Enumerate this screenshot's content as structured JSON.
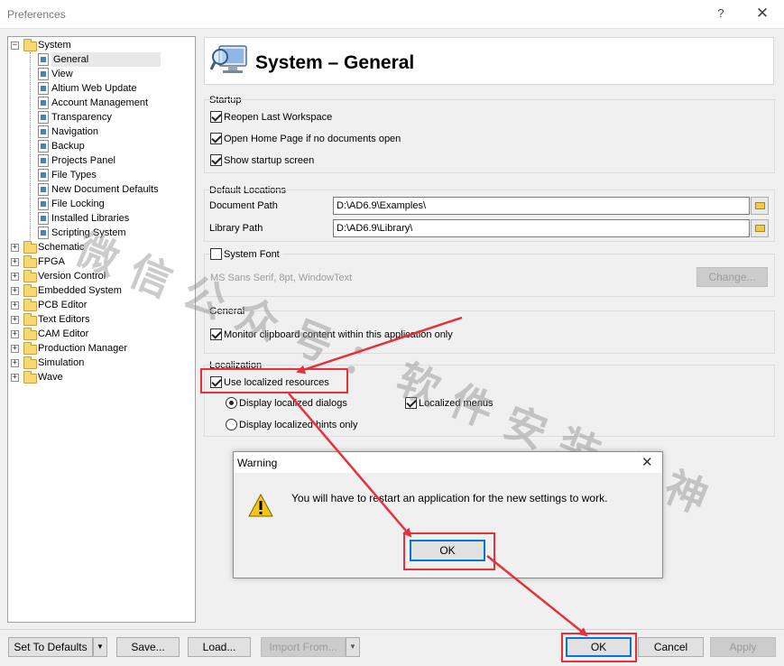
{
  "window": {
    "title": "Preferences",
    "help": "?",
    "close": "✕"
  },
  "tree": {
    "items": [
      {
        "label": "System",
        "expander": "−"
      },
      {
        "label": "General"
      },
      {
        "label": "View"
      },
      {
        "label": "Altium Web Update"
      },
      {
        "label": "Account Management"
      },
      {
        "label": "Transparency"
      },
      {
        "label": "Navigation"
      },
      {
        "label": "Backup"
      },
      {
        "label": "Projects Panel"
      },
      {
        "label": "File Types"
      },
      {
        "label": "New Document Defaults"
      },
      {
        "label": "File Locking"
      },
      {
        "label": "Installed Libraries"
      },
      {
        "label": "Scripting System"
      },
      {
        "label": "Schematic",
        "expander": "+"
      },
      {
        "label": "FPGA",
        "expander": "+"
      },
      {
        "label": "Version Control",
        "expander": "+"
      },
      {
        "label": "Embedded System",
        "expander": "+"
      },
      {
        "label": "PCB Editor",
        "expander": "+"
      },
      {
        "label": "Text Editors",
        "expander": "+"
      },
      {
        "label": "CAM Editor",
        "expander": "+"
      },
      {
        "label": "Production Manager",
        "expander": "+"
      },
      {
        "label": "Simulation",
        "expander": "+"
      },
      {
        "label": "Wave",
        "expander": "+"
      }
    ]
  },
  "header": {
    "title": "System – General",
    "icon": "monitor-magnifier-icon"
  },
  "startup": {
    "label": "Startup",
    "reopen": "Reopen Last Workspace",
    "home_page": "Open Home Page if no documents open",
    "startup_screen": "Show startup screen"
  },
  "locations": {
    "label": "Default Locations",
    "document_label": "Document Path",
    "document_value": "D:\\AD6.9\\Examples\\",
    "library_label": "Library Path",
    "library_value": "D:\\AD6.9\\Library\\"
  },
  "font": {
    "checkbox_label": "System Font",
    "font_value": "MS Sans Serif, 8pt, WindowText",
    "change_button": "Change..."
  },
  "general": {
    "label": "General",
    "monitor_clipboard": "Monitor clipboard content within this application only"
  },
  "localization": {
    "label": "Localization",
    "use_localized": "Use localized resources",
    "display_dialogs": "Display localized dialogs",
    "localized_menus": "Localized menus",
    "display_hints": "Display localized hints only"
  },
  "warning": {
    "title": "Warning",
    "close": "✕",
    "icon": "warning-triangle-icon",
    "message": "You will have to restart an application for the new settings to work.",
    "ok": "OK"
  },
  "footer": {
    "set_defaults": "Set To Defaults",
    "save": "Save...",
    "load": "Load...",
    "import_from": "Import From...",
    "ok": "OK",
    "cancel": "Cancel",
    "apply": "Apply"
  },
  "overlay": {
    "watermark": "微信公众号：软件安装大神",
    "highlight_color": "#e8303a"
  }
}
